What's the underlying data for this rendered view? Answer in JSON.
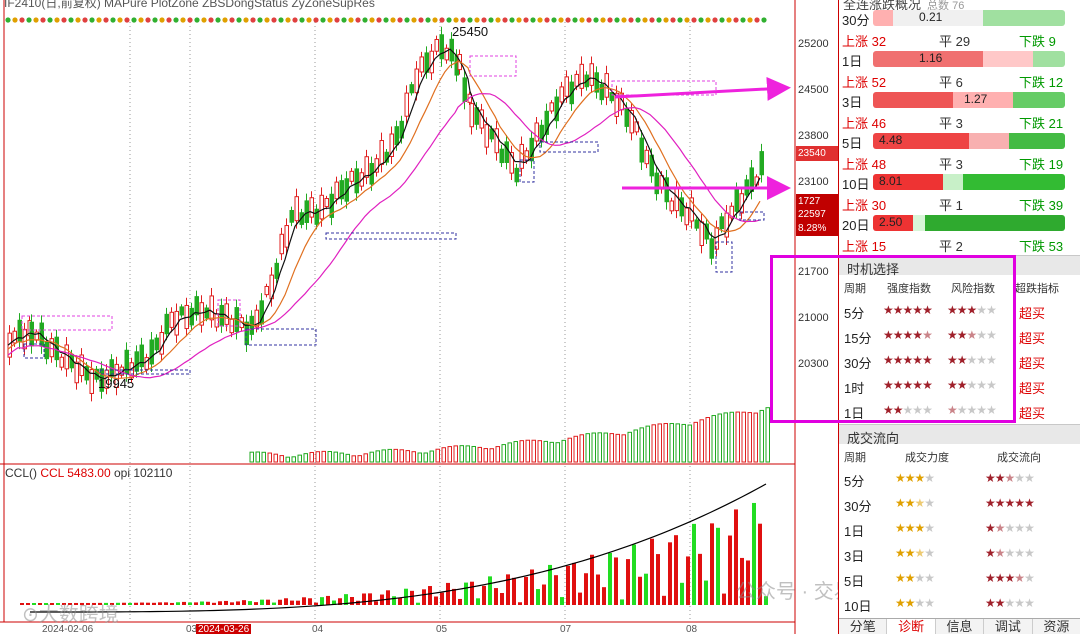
{
  "chart": {
    "header_text": "IF2410(日,前复权)  MAPure  PlotZone  ZBSDongStatus  ZyZoneSupRes",
    "high_label": "25450",
    "low_label": "19945",
    "price_levels": [
      "25200",
      "24500",
      "23800",
      "23100",
      "21700",
      "21000",
      "20300"
    ],
    "price_tags": [
      {
        "text": "23540",
        "color": "#e03030"
      },
      {
        "text": "1727",
        "color": "#c00000"
      },
      {
        "text": "22597",
        "color": "#c00000"
      },
      {
        "text": "8.28%",
        "color": "#c00000"
      }
    ],
    "ccl_legend": {
      "name": "CCL()",
      "ccl": "CCL 5483.00",
      "opi": "opi 102110"
    },
    "dates": [
      {
        "text": "2024-02-06",
        "highlight": false
      },
      {
        "text": "03",
        "highlight": false
      },
      {
        "text": "2024-03-26",
        "highlight": true
      },
      {
        "text": "04",
        "highlight": false
      },
      {
        "text": "05",
        "highlight": false
      },
      {
        "text": "07",
        "highlight": false
      },
      {
        "text": "08",
        "highlight": false
      }
    ],
    "watermark_left": "大数跨境",
    "watermark_right": "公众号 · 交易开拓者TB",
    "colors": {
      "up": "#e02020",
      "down": "#22aa22",
      "ma1": "#111111",
      "ma2": "#e07020",
      "ma3": "#e020c0",
      "arrow": "#ee22dd"
    }
  },
  "panel": {
    "title": "全连涨跌概况",
    "subtitle": "总数 76",
    "stats": [
      {
        "period": "30分",
        "value": "0.21",
        "up": "上涨 32",
        "flat": "平 29",
        "down": "下跌 9",
        "segments": [
          {
            "w": 20,
            "c": "#ffb0b0"
          },
          {
            "w": 90,
            "c": "#f0f0f0"
          },
          {
            "w": 82,
            "c": "#a0e0a0"
          }
        ]
      },
      {
        "period": "1日",
        "value": "1.16",
        "up": "上涨 52",
        "flat": "平 6",
        "down": "下跌 12",
        "segments": [
          {
            "w": 110,
            "c": "#f07070"
          },
          {
            "w": 50,
            "c": "#ffc8c8"
          },
          {
            "w": 32,
            "c": "#a0e0a0"
          }
        ]
      },
      {
        "period": "3日",
        "value": "1.27",
        "up": "上涨 46",
        "flat": "平 3",
        "down": "下跌 21",
        "segments": [
          {
            "w": 80,
            "c": "#ee5555"
          },
          {
            "w": 60,
            "c": "#ffb0b0"
          },
          {
            "w": 52,
            "c": "#66cc66"
          }
        ]
      },
      {
        "period": "5日",
        "value": "4.48",
        "up": "上涨 48",
        "flat": "平 3",
        "down": "下跌 19",
        "segments": [
          {
            "w": 96,
            "c": "#ee4444"
          },
          {
            "w": 40,
            "c": "#f8b0b0"
          },
          {
            "w": 56,
            "c": "#44bb44"
          }
        ]
      },
      {
        "period": "10日",
        "value": "8.01",
        "up": "上涨 30",
        "flat": "平 1",
        "down": "下跌 39",
        "segments": [
          {
            "w": 70,
            "c": "#ee3333"
          },
          {
            "w": 20,
            "c": "#c8f0c8"
          },
          {
            "w": 102,
            "c": "#33bb33"
          }
        ]
      },
      {
        "period": "20日",
        "value": "2.50",
        "up": "上涨 15",
        "flat": "平 2",
        "down": "下跌 53",
        "segments": [
          {
            "w": 40,
            "c": "#ee3333"
          },
          {
            "w": 12,
            "c": "#d8f5d8"
          },
          {
            "w": 140,
            "c": "#2faa2f"
          }
        ]
      }
    ],
    "timing": {
      "title": "时机选择",
      "headers": [
        "周期",
        "强度指数",
        "风险指数",
        "超跌指标"
      ],
      "rows": [
        {
          "period": "5分",
          "strength": 5,
          "risk": 3,
          "signal": "超买"
        },
        {
          "period": "15分",
          "strength": 4.5,
          "risk": 2.5,
          "signal": "超买"
        },
        {
          "period": "30分",
          "strength": 5,
          "risk": 2,
          "signal": "超买"
        },
        {
          "period": "1时",
          "strength": 5,
          "risk": 2,
          "signal": "超买"
        },
        {
          "period": "1日",
          "strength": 2,
          "risk": 0.5,
          "signal": "超买"
        }
      ]
    },
    "flow": {
      "title": "成交流向",
      "headers": [
        "周期",
        "成交力度",
        "成交流向"
      ],
      "rows": [
        {
          "period": "5分",
          "force": 3,
          "direction": 2.5
        },
        {
          "period": "30分",
          "force": 2.5,
          "direction": 5
        },
        {
          "period": "1日",
          "force": 3,
          "direction": 1.5
        },
        {
          "period": "3日",
          "force": 2.5,
          "direction": 1.5
        },
        {
          "period": "5日",
          "force": 2,
          "direction": 3.5
        },
        {
          "period": "10日",
          "force": 2,
          "direction": 2
        }
      ]
    },
    "tabs": [
      "分笔",
      "诊断",
      "信息",
      "调试",
      "资源"
    ],
    "active_tab": 1
  }
}
